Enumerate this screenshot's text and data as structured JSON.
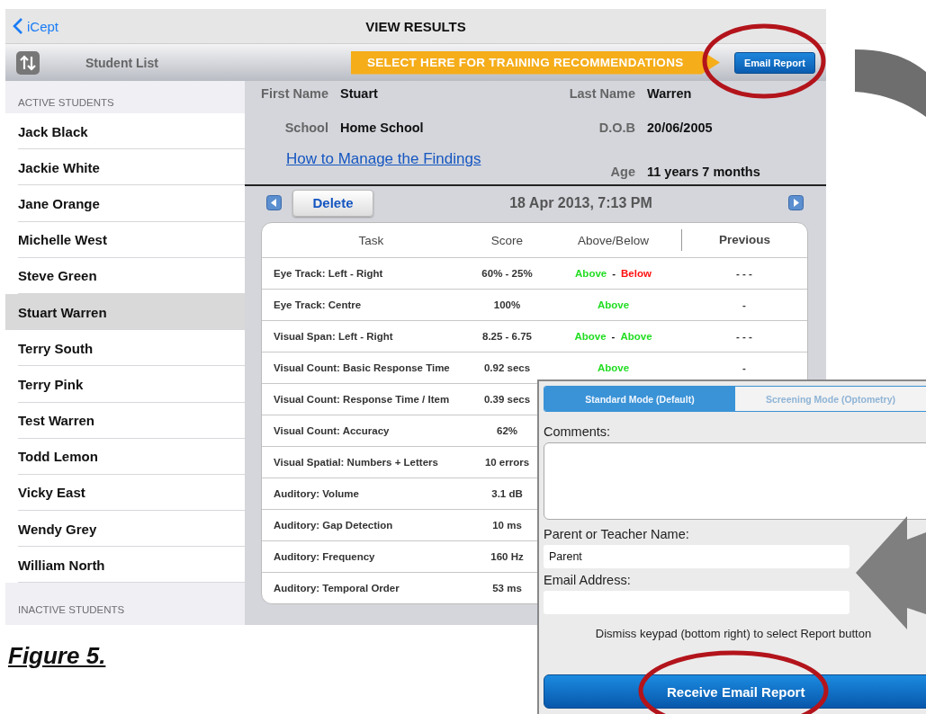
{
  "nav": {
    "back": "iCept",
    "title": "VIEW RESULTS"
  },
  "toolbar": {
    "sidebar_title": "Student List",
    "banner": "SELECT HERE FOR TRAINING RECOMMENDATIONS",
    "email_button": "Email Report"
  },
  "sidebar": {
    "active_header": "ACTIVE STUDENTS",
    "students": [
      {
        "name": "Jack Black",
        "selected": false
      },
      {
        "name": "Jackie White",
        "selected": false
      },
      {
        "name": "Jane Orange",
        "selected": false
      },
      {
        "name": "Michelle West",
        "selected": false
      },
      {
        "name": "Steve Green",
        "selected": false
      },
      {
        "name": "Stuart Warren",
        "selected": true
      },
      {
        "name": "Terry South",
        "selected": false
      },
      {
        "name": "Terry Pink",
        "selected": false
      },
      {
        "name": "Test Warren",
        "selected": false
      },
      {
        "name": "Todd Lemon",
        "selected": false
      },
      {
        "name": "Vicky East",
        "selected": false
      },
      {
        "name": "Wendy Grey",
        "selected": false
      },
      {
        "name": "William North",
        "selected": false
      }
    ],
    "inactive_header": "INACTIVE STUDENTS"
  },
  "student": {
    "fields": [
      {
        "label": "First Name",
        "value": "Stuart"
      },
      {
        "label": "Last Name",
        "value": "Warren"
      },
      {
        "label": "School",
        "value": "Home School"
      },
      {
        "label": "D.O.B",
        "value": "20/06/2005"
      },
      {
        "label": "Age",
        "value": "11 years 7 months"
      }
    ],
    "link": "How to Manage the Findings"
  },
  "session": {
    "delete_button": "Delete",
    "date": "18 Apr 2013, 7:13 PM"
  },
  "table": {
    "columns": [
      "Task",
      "Score",
      "Above/Below",
      "Previous"
    ],
    "rows": [
      {
        "task": "Eye Track: Left - Right",
        "score": "60% - 25%",
        "result": [
          {
            "text": "Above",
            "color": "#22dd22"
          },
          {
            "text": "-",
            "kind": "separator"
          },
          {
            "text": "Below",
            "color": "#ff1010"
          }
        ],
        "previous": "- - -"
      },
      {
        "task": "Eye Track: Centre",
        "score": "100%",
        "result": [
          {
            "text": "Above",
            "color": "#22dd22"
          }
        ],
        "previous": "-"
      },
      {
        "task": "Visual Span: Left - Right",
        "score": "8.25 - 6.75",
        "result": [
          {
            "text": "Above",
            "color": "#22dd22"
          },
          {
            "text": "-",
            "kind": "separator"
          },
          {
            "text": "Above",
            "color": "#22dd22"
          }
        ],
        "previous": "- - -"
      },
      {
        "task": "Visual Count: Basic Response Time",
        "score": "0.92 secs",
        "result": [
          {
            "text": "Above",
            "color": "#22dd22"
          }
        ],
        "previous": "-"
      },
      {
        "task": "Visual Count: Response Time / Item",
        "score": "0.39 secs"
      },
      {
        "task": "Visual Count: Accuracy",
        "score": "62%"
      },
      {
        "task": "Visual Spatial: Numbers + Letters",
        "score": "10 errors"
      },
      {
        "task": "Auditory: Volume",
        "score": "3.1 dB"
      },
      {
        "task": "Auditory: Gap Detection",
        "score": "10 ms"
      },
      {
        "task": "Auditory: Frequency",
        "score": "160 Hz"
      },
      {
        "task": "Auditory: Temporal Order",
        "score": "53 ms"
      }
    ]
  },
  "email_form": {
    "tabs": [
      {
        "label": "Standard Mode (Default)",
        "selected": true
      },
      {
        "label": "Screening Mode (Optometry)",
        "selected": false
      }
    ],
    "comments_label": "Comments:",
    "name_label": "Parent or Teacher Name:",
    "name_value": "Parent",
    "email_label": "Email Address:",
    "hint": "Dismiss keypad (bottom right) to select Report button",
    "submit": "Receive Email Report"
  },
  "caption": "Figure 5."
}
